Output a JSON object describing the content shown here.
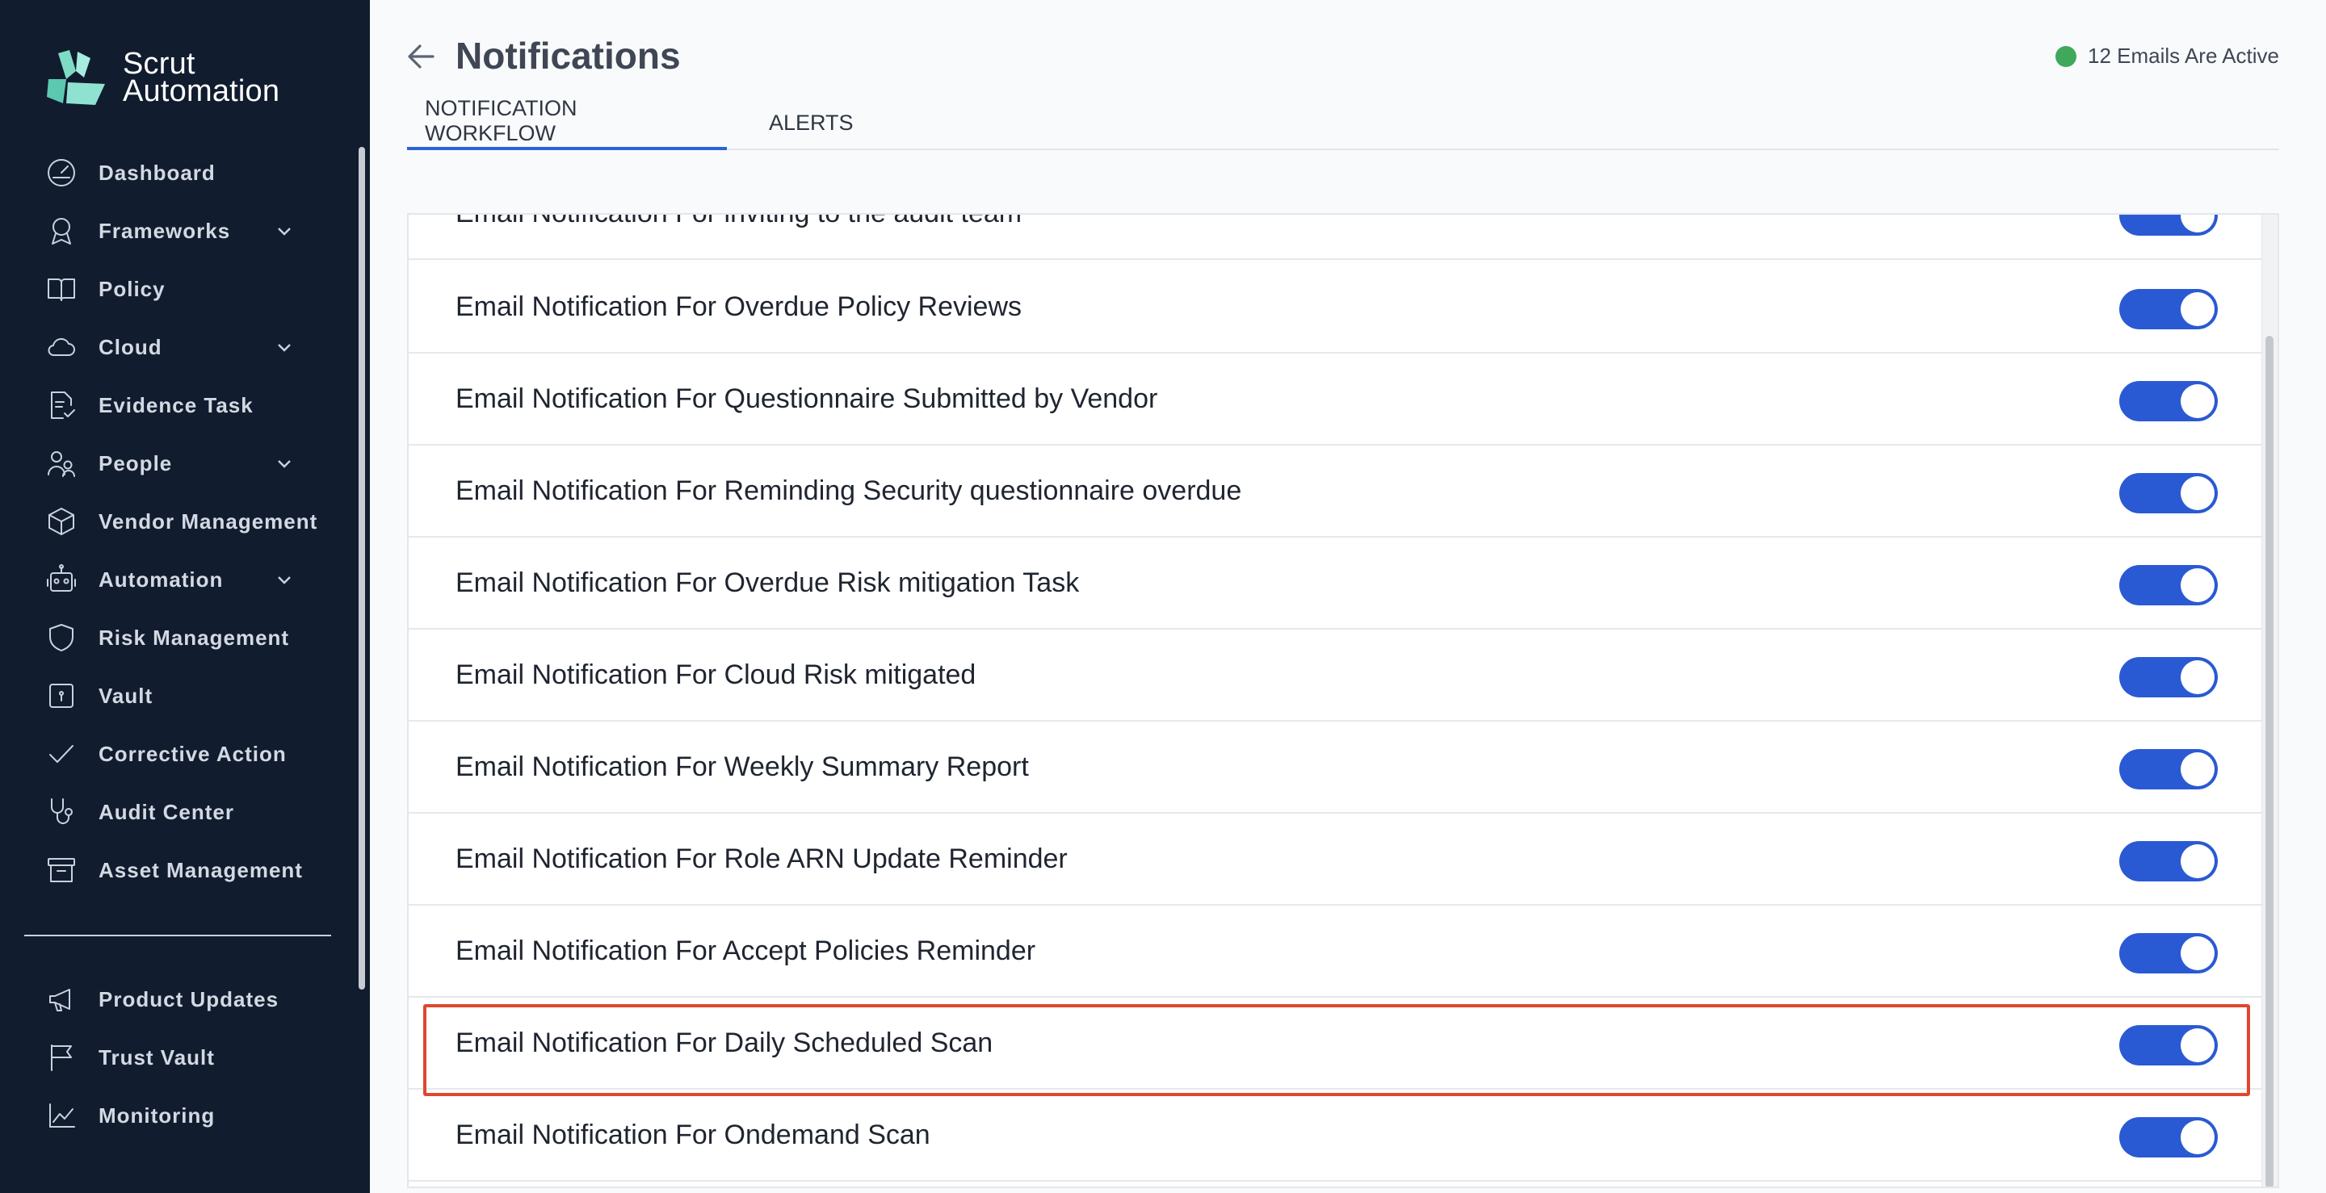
{
  "app": {
    "logo_line1": "Scrut",
    "logo_line2": "Automation"
  },
  "sidebar": {
    "items": [
      {
        "label": "Dashboard",
        "icon": "dashboard-icon"
      },
      {
        "label": "Frameworks",
        "icon": "award-icon",
        "expandable": true
      },
      {
        "label": "Policy",
        "icon": "book-icon"
      },
      {
        "label": "Cloud",
        "icon": "cloud-icon",
        "expandable": true
      },
      {
        "label": "Evidence Task",
        "icon": "document-check-icon"
      },
      {
        "label": "People",
        "icon": "people-icon",
        "expandable": true
      },
      {
        "label": "Vendor Management",
        "icon": "package-icon"
      },
      {
        "label": "Automation",
        "icon": "robot-icon",
        "expandable": true
      },
      {
        "label": "Risk Management",
        "icon": "shield-icon"
      },
      {
        "label": "Vault",
        "icon": "vault-icon"
      },
      {
        "label": "Corrective Action",
        "icon": "check-icon"
      },
      {
        "label": "Audit Center",
        "icon": "stethoscope-icon"
      },
      {
        "label": "Asset Management",
        "icon": "archive-icon"
      }
    ],
    "secondary_items": [
      {
        "label": "Product Updates",
        "icon": "megaphone-icon"
      },
      {
        "label": "Trust Vault",
        "icon": "flag-icon"
      },
      {
        "label": "Monitoring",
        "icon": "chart-line-icon"
      }
    ]
  },
  "header": {
    "title": "Notifications",
    "status_text": "12 Emails Are Active",
    "status_color": "#3fa85b"
  },
  "tabs": [
    {
      "label": "NOTIFICATION WORKFLOW",
      "active": true
    },
    {
      "label": "ALERTS",
      "active": false
    }
  ],
  "notifications": [
    {
      "label": "Email Notification For inviting to the audit team",
      "enabled": true
    },
    {
      "label": "Email Notification For Overdue Policy Reviews",
      "enabled": true
    },
    {
      "label": "Email Notification For Questionnaire Submitted by Vendor",
      "enabled": true
    },
    {
      "label": "Email Notification For Reminding Security questionnaire overdue",
      "enabled": true
    },
    {
      "label": "Email Notification For Overdue Risk mitigation Task",
      "enabled": true
    },
    {
      "label": "Email Notification For Cloud Risk mitigated",
      "enabled": true
    },
    {
      "label": "Email Notification For Weekly Summary Report",
      "enabled": true
    },
    {
      "label": "Email Notification For Role ARN Update Reminder",
      "enabled": true
    },
    {
      "label": "Email Notification For Accept Policies Reminder",
      "enabled": true
    },
    {
      "label": "Email Notification For Daily Scheduled Scan",
      "enabled": true,
      "highlighted": true
    },
    {
      "label": "Email Notification For Ondemand Scan",
      "enabled": true
    }
  ],
  "colors": {
    "sidebar_bg": "#111c2e",
    "toggle_on": "#2a5ad3",
    "tab_active": "#2a63d6",
    "highlight": "#e0472f"
  }
}
